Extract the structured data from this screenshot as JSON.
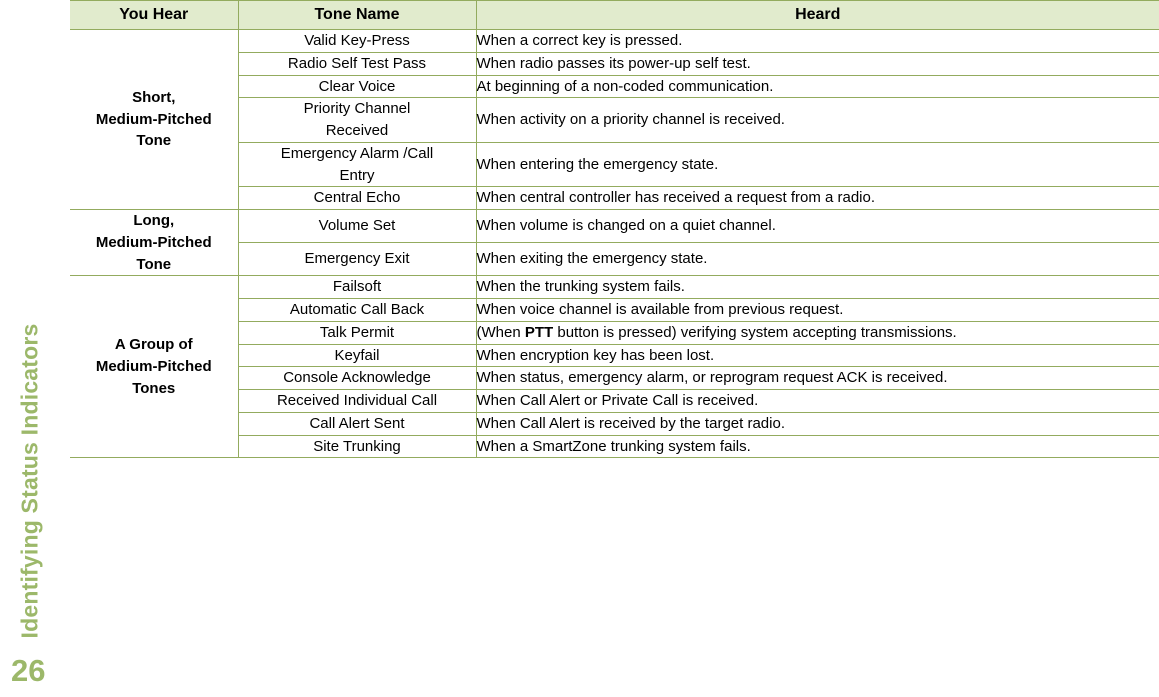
{
  "sidebar": {
    "chapter_title": "Identifying Status Indicators",
    "page_number": "26"
  },
  "colors": {
    "accent_green": "#9cb86a",
    "border_green": "#93ab5e",
    "header_bg": "#e1ebcd",
    "text": "#000000"
  },
  "table": {
    "headers": {
      "you_hear": "You Hear",
      "tone_name": "Tone Name",
      "heard": "Heard"
    },
    "groups": [
      {
        "you_hear": "Short,\nMedium-Pitched\nTone",
        "rows": [
          {
            "tone_name": "Valid Key-Press",
            "heard_pre": "When a correct key is pressed.",
            "heard_bold": "",
            "heard_post": ""
          },
          {
            "tone_name": "Radio Self Test Pass",
            "heard_pre": "When radio passes its power-up self test.",
            "heard_bold": "",
            "heard_post": ""
          },
          {
            "tone_name": "Clear Voice",
            "heard_pre": "At beginning of a non-coded communication.",
            "heard_bold": "",
            "heard_post": ""
          },
          {
            "tone_name": "Priority Channel\nReceived",
            "heard_pre": "When activity on a priority channel is received.",
            "heard_bold": "",
            "heard_post": ""
          },
          {
            "tone_name": "Emergency Alarm /Call\nEntry",
            "heard_pre": "When entering the emergency state.",
            "heard_bold": "",
            "heard_post": ""
          },
          {
            "tone_name": "Central Echo",
            "heard_pre": "When central controller has received a request from a radio.",
            "heard_bold": "",
            "heard_post": ""
          }
        ]
      },
      {
        "you_hear": "Long,\nMedium-Pitched\nTone",
        "rows": [
          {
            "tone_name": "Volume Set",
            "heard_pre": "When volume is changed on a quiet channel.",
            "heard_bold": "",
            "heard_post": ""
          },
          {
            "tone_name": "Emergency Exit",
            "heard_pre": "When exiting the emergency state.",
            "heard_bold": "",
            "heard_post": ""
          }
        ]
      },
      {
        "you_hear": "A Group of\nMedium-Pitched\nTones",
        "rows": [
          {
            "tone_name": "Failsoft",
            "heard_pre": "When the trunking system fails.",
            "heard_bold": "",
            "heard_post": ""
          },
          {
            "tone_name": "Automatic Call Back",
            "heard_pre": "When voice channel is available from previous request.",
            "heard_bold": "",
            "heard_post": ""
          },
          {
            "tone_name": "Talk Permit",
            "heard_pre": "(When ",
            "heard_bold": "PTT",
            "heard_post": " button is pressed) verifying system accepting transmissions."
          },
          {
            "tone_name": "Keyfail",
            "heard_pre": "When encryption key has been lost.",
            "heard_bold": "",
            "heard_post": ""
          },
          {
            "tone_name": "Console Acknowledge",
            "heard_pre": "When status, emergency alarm, or reprogram request ACK is received.",
            "heard_bold": "",
            "heard_post": ""
          },
          {
            "tone_name": "Received Individual Call",
            "heard_pre": "When Call Alert or Private Call is received.",
            "heard_bold": "",
            "heard_post": ""
          },
          {
            "tone_name": "Call Alert Sent",
            "heard_pre": "When Call Alert is received by the target radio.",
            "heard_bold": "",
            "heard_post": ""
          },
          {
            "tone_name": "Site Trunking",
            "heard_pre": "When a SmartZone trunking system fails.",
            "heard_bold": "",
            "heard_post": ""
          }
        ]
      }
    ]
  }
}
